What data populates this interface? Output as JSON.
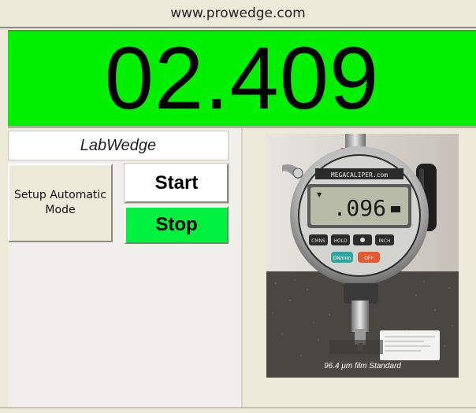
{
  "header": {
    "url_text": "www.prowedge.com"
  },
  "display": {
    "reading": "02.409",
    "background_color": "#00f000"
  },
  "controls": {
    "app_label": "LabWedge",
    "setup_button_label": "Setup Automatic Mode",
    "start_button_label": "Start",
    "stop_button_label": "Stop",
    "stop_button_color": "#00f040"
  },
  "photo": {
    "brand_text": "MEGACALIPER.com",
    "lcd_reading": ".096",
    "button_labels": [
      "CMNS",
      "HOLD",
      "",
      "INCH"
    ],
    "on_label": "ON/mm",
    "off_label": "OFF",
    "caption": "96.4 μm film Standard"
  }
}
